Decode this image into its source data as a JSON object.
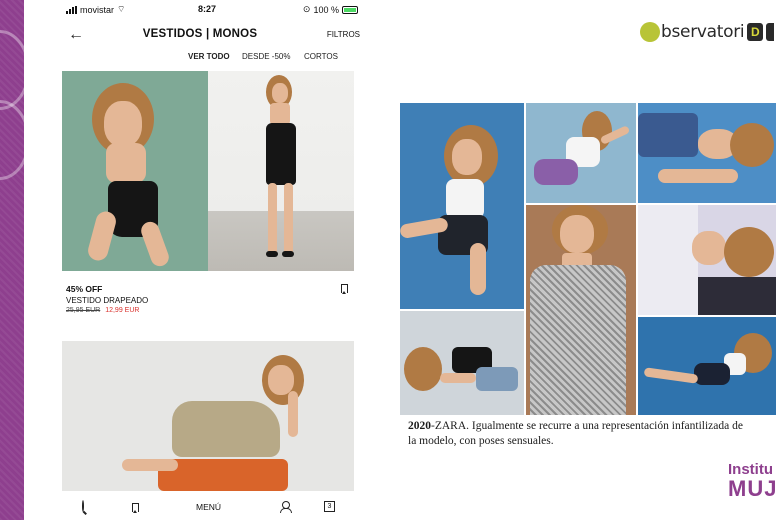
{
  "status_bar": {
    "carrier": "movistar",
    "time": "8:27",
    "battery": "100 %"
  },
  "header": {
    "title": "VESTIDOS | MONOS",
    "filters_label": "FILTROS",
    "back_icon": "arrow-left-icon"
  },
  "subtabs": [
    {
      "label": "VER TODO",
      "active": true
    },
    {
      "label": "DESDE -50%",
      "active": false
    },
    {
      "label": "CORTOS",
      "active": false
    }
  ],
  "product": {
    "discount": "45% OFF",
    "name": "VESTIDO DRAPEADO",
    "old_price": "25,95 EUR",
    "new_price": "12,99 EUR",
    "sale_color": "#d9302c"
  },
  "bottom_nav": {
    "menu_label": "MENÚ",
    "bag_count": "3",
    "icons": [
      "search-icon",
      "bookmark-icon",
      "user-icon",
      "shopping-bag-icon"
    ]
  },
  "logo": {
    "text": "bservatori",
    "box_letter": "D",
    "accent": "#b8c437"
  },
  "caption": {
    "year": "2020",
    "text": "-ZARA. Igualmente se recurre a una representación infantilizada de la modelo, con poses sensuales."
  },
  "institute_logo": {
    "line1": "Institu",
    "line2": "MUJ"
  },
  "colors": {
    "brand_purple": "#8e3f8e",
    "logo_green": "#b8c437"
  }
}
